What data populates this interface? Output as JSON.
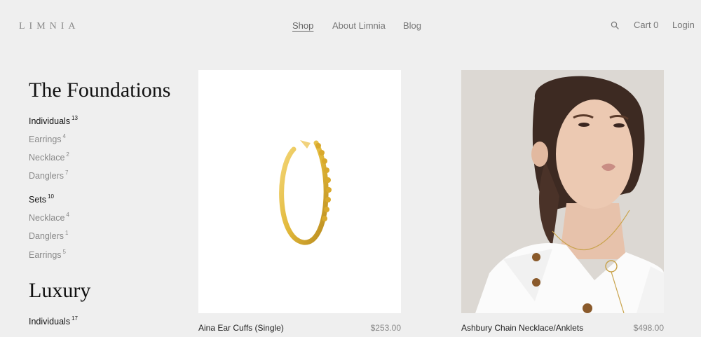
{
  "header": {
    "logo": "LIMNIA",
    "nav": [
      "Shop",
      "About Limnia",
      "Blog"
    ],
    "cart_label": "Cart 0",
    "login_label": "Login",
    "search_icon": "search-icon"
  },
  "sidebar": {
    "sections": [
      {
        "title": "The Foundations",
        "groups": [
          {
            "label": "Individuals",
            "count": "13",
            "items": [
              {
                "label": "Earrings",
                "count": "4"
              },
              {
                "label": "Necklace",
                "count": "2"
              },
              {
                "label": "Danglers",
                "count": "7"
              }
            ]
          },
          {
            "label": "Sets",
            "count": "10",
            "items": [
              {
                "label": "Necklace",
                "count": "4"
              },
              {
                "label": "Danglers",
                "count": "1"
              },
              {
                "label": "Earrings",
                "count": "5"
              }
            ]
          }
        ]
      },
      {
        "title": "Luxury",
        "groups": [
          {
            "label": "Individuals",
            "count": "17",
            "items": []
          }
        ]
      }
    ]
  },
  "products": [
    {
      "name": "Aina Ear Cuffs (Single)",
      "price": "$253.00"
    },
    {
      "name": "Ashbury Chain Necklace/Anklets",
      "price": "$498.00"
    }
  ],
  "colors": {
    "background": "#efefef",
    "ring_gold": "#e2b93b"
  }
}
